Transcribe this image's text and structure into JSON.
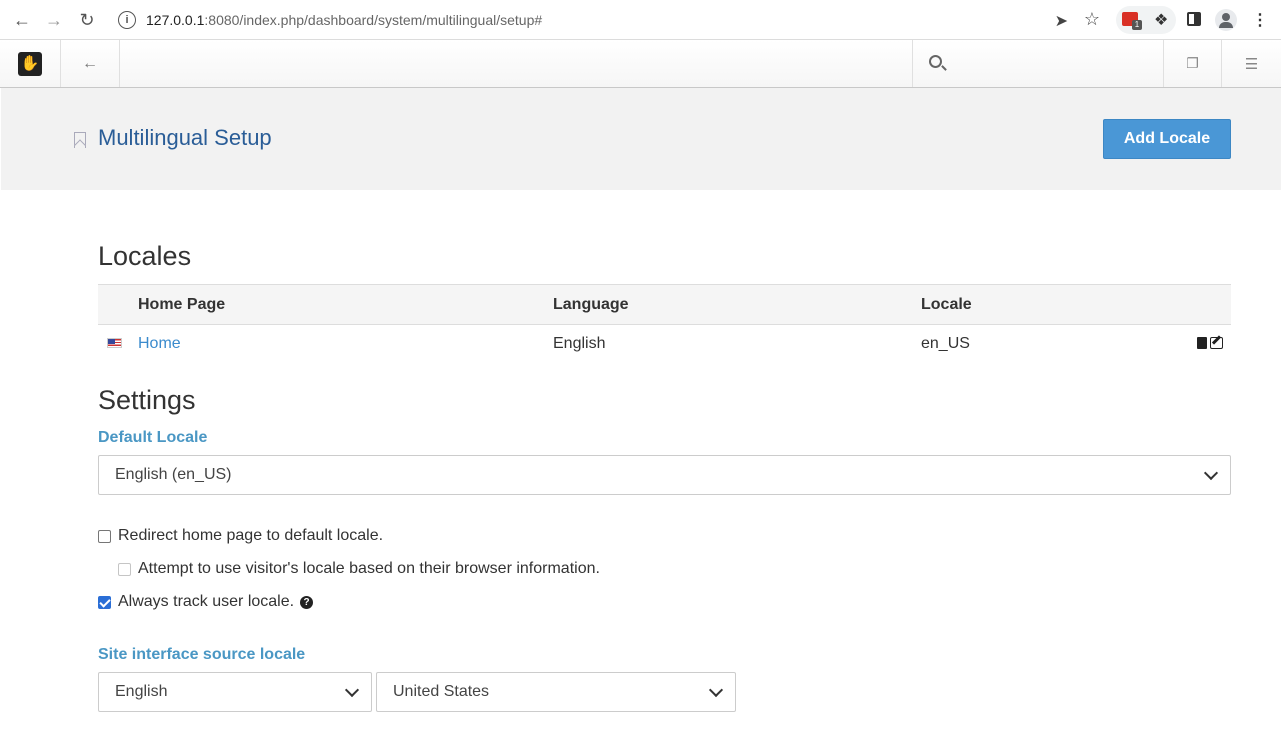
{
  "browser": {
    "url_host": "127.0.0.1",
    "url_rest": ":8080/index.php/dashboard/system/multilingual/setup#",
    "ext_badge": "1"
  },
  "cms_toolbar": {
    "logo_glyph": "✋"
  },
  "header": {
    "title": "Multilingual Setup",
    "add_locale_label": "Add Locale"
  },
  "locales": {
    "heading": "Locales",
    "columns": [
      "Home Page",
      "Language",
      "Locale"
    ],
    "rows": [
      {
        "home_page": "Home",
        "language": "English",
        "locale": "en_US"
      }
    ]
  },
  "settings": {
    "heading": "Settings",
    "default_locale_label": "Default Locale",
    "default_locale_value": "English (en_US)",
    "redirect_label": "Redirect home page to default locale.",
    "redirect_checked": false,
    "attempt_label": "Attempt to use visitor's locale based on their browser information.",
    "attempt_checked": false,
    "track_label": "Always track user locale.",
    "track_checked": true,
    "source_locale_label": "Site interface source locale",
    "source_language": "English",
    "source_country": "United States"
  }
}
